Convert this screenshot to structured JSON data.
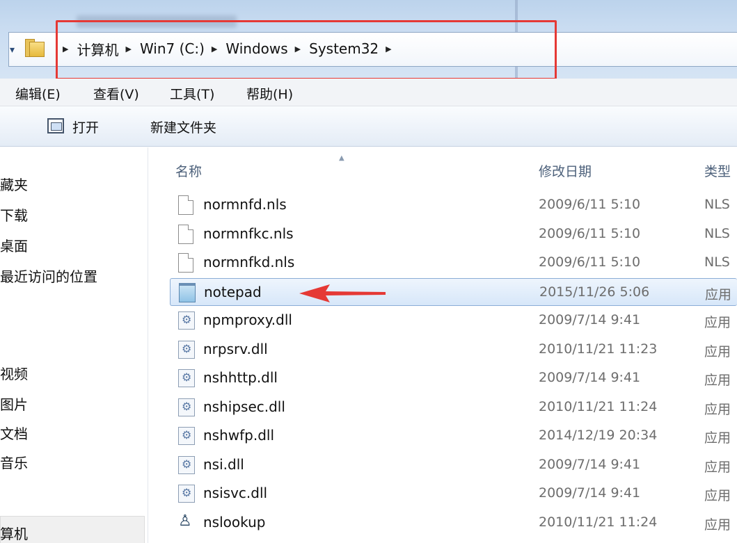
{
  "address": {
    "crumbs": [
      "计算机",
      "Win7 (C:)",
      "Windows",
      "System32"
    ]
  },
  "menu": {
    "edit": "编辑(E)",
    "view": "查看(V)",
    "tools": "工具(T)",
    "help": "帮助(H)"
  },
  "toolbar": {
    "open": "打开",
    "new_folder": "新建文件夹"
  },
  "nav": {
    "items": [
      "藏夹",
      "下载",
      "桌面",
      "最近访问的位置",
      "视频",
      "图片",
      "文档",
      "音乐",
      "算机"
    ]
  },
  "columns": {
    "name": "名称",
    "date": "修改日期",
    "type": "类型"
  },
  "files": [
    {
      "name": "normnfd.nls",
      "date": "2009/6/11 5:10",
      "type": "NLS",
      "icon": "doc"
    },
    {
      "name": "normnfkc.nls",
      "date": "2009/6/11 5:10",
      "type": "NLS",
      "icon": "doc"
    },
    {
      "name": "normnfkd.nls",
      "date": "2009/6/11 5:10",
      "type": "NLS",
      "icon": "doc"
    },
    {
      "name": "notepad",
      "date": "2015/11/26 5:06",
      "type": "应用",
      "icon": "notepad",
      "selected": true
    },
    {
      "name": "npmproxy.dll",
      "date": "2009/7/14 9:41",
      "type": "应用",
      "icon": "dll"
    },
    {
      "name": "nrpsrv.dll",
      "date": "2010/11/21 11:23",
      "type": "应用",
      "icon": "dll"
    },
    {
      "name": "nshhttp.dll",
      "date": "2009/7/14 9:41",
      "type": "应用",
      "icon": "dll"
    },
    {
      "name": "nshipsec.dll",
      "date": "2010/11/21 11:24",
      "type": "应用",
      "icon": "dll"
    },
    {
      "name": "nshwfp.dll",
      "date": "2014/12/19 20:34",
      "type": "应用",
      "icon": "dll"
    },
    {
      "name": "nsi.dll",
      "date": "2009/7/14 9:41",
      "type": "应用",
      "icon": "dll"
    },
    {
      "name": "nsisvc.dll",
      "date": "2009/7/14 9:41",
      "type": "应用",
      "icon": "dll"
    },
    {
      "name": "nslookup",
      "date": "2010/11/21 11:24",
      "type": "应用",
      "icon": "app"
    }
  ],
  "colors": {
    "highlight_box": "#e53935",
    "selection_border": "#89acd6",
    "arrow": "#e53935"
  }
}
